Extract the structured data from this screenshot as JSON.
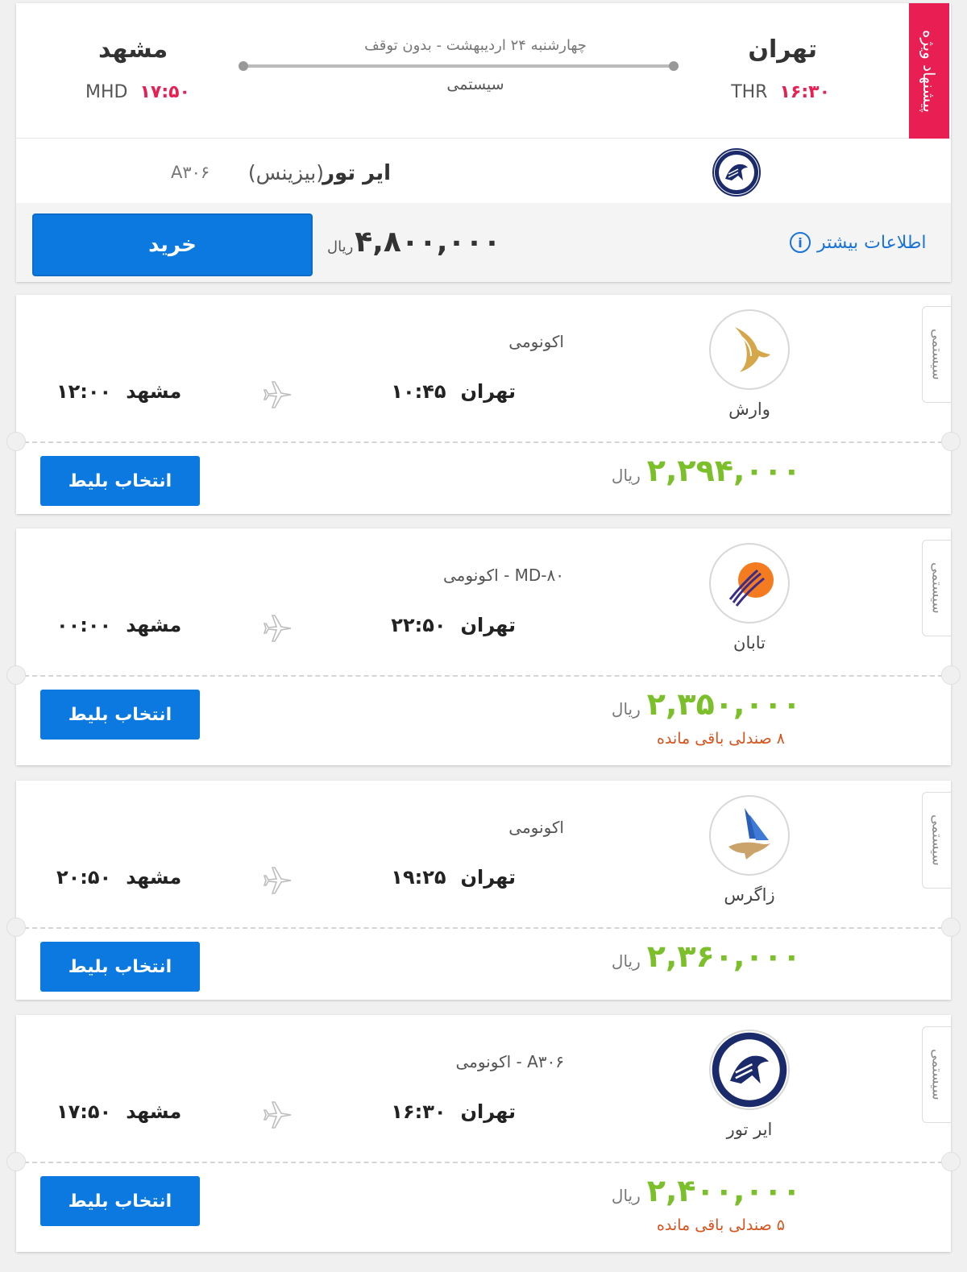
{
  "special": {
    "ribbon": "پیشنهاد ویژه",
    "origin_city": "تهران",
    "origin_code": "THR",
    "origin_time": "۱۶:۳۰",
    "dest_city": "مشهد",
    "dest_code": "MHD",
    "dest_time": "۱۷:۵۰",
    "date_line": "چهارشنبه ۲۴ اردیبهشت - بدون توقف",
    "system_label": "سیستمی",
    "airline": "ایر تور",
    "cabin": "(بیزینس)",
    "flight_no": "A۳۰۶",
    "price": "۴,۸۰۰,۰۰۰",
    "currency": "ریال",
    "buy_label": "خرید",
    "more_info": "اطلاعات بیشتر",
    "logo_icon": "airtour-logo-icon"
  },
  "flights": [
    {
      "tag": "سیستمی",
      "airline": "وارش",
      "logo_icon": "varesh-logo-icon",
      "subinfo": "اکونومی",
      "origin": "تهران",
      "depart": "۱۰:۴۵",
      "dest": "مشهد",
      "arrive": "۱۲:۰۰",
      "price": "۲,۲۹۴,۰۰۰",
      "currency": "ریال",
      "select_label": "انتخاب بلیط",
      "seats": ""
    },
    {
      "tag": "سیستمی",
      "airline": "تابان",
      "logo_icon": "taban-logo-icon",
      "subinfo": "MD-۸۰ - اکونومی",
      "origin": "تهران",
      "depart": "۲۲:۵۰",
      "dest": "مشهد",
      "arrive": "۰۰:۰۰",
      "price": "۲,۳۵۰,۰۰۰",
      "currency": "ریال",
      "select_label": "انتخاب بلیط",
      "seats": "۸ صندلی باقی مانده"
    },
    {
      "tag": "سیستمی",
      "airline": "زاگرس",
      "logo_icon": "zagros-logo-icon",
      "subinfo": "اکونومی",
      "origin": "تهران",
      "depart": "۱۹:۲۵",
      "dest": "مشهد",
      "arrive": "۲۰:۵۰",
      "price": "۲,۳۶۰,۰۰۰",
      "currency": "ریال",
      "select_label": "انتخاب بلیط",
      "seats": ""
    },
    {
      "tag": "سیستمی",
      "airline": "ایر تور",
      "logo_icon": "airtour-logo-icon",
      "subinfo": "A۳۰۶ - اکونومی",
      "origin": "تهران",
      "depart": "۱۶:۳۰",
      "dest": "مشهد",
      "arrive": "۱۷:۵۰",
      "price": "۲,۴۰۰,۰۰۰",
      "currency": "ریال",
      "select_label": "انتخاب بلیط",
      "seats": "۵ صندلی باقی مانده"
    }
  ],
  "colors": {
    "accent_blue": "#0b79e0",
    "special_red": "#e91e52",
    "price_green": "#7bbf2a",
    "seats_orange": "#d9531e"
  }
}
